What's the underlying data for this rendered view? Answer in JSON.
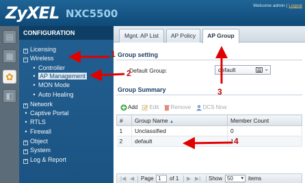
{
  "header": {
    "brand": "ZyXEL",
    "model": "NXC5500",
    "welcome": "Welcome admin |",
    "logout": "Logout"
  },
  "rail": {
    "icons": [
      "dashboard-icon",
      "monitor-icon",
      "configuration-icon",
      "maintenance-icon"
    ],
    "active": "configuration-icon"
  },
  "sidebar": {
    "title": "CONFIGURATION",
    "items": [
      {
        "label": "Licensing",
        "type": "collapsed"
      },
      {
        "label": "Wireless",
        "type": "expanded"
      },
      {
        "label": "Controller",
        "type": "child"
      },
      {
        "label": "AP Management",
        "type": "child",
        "selected": true
      },
      {
        "label": "MON Mode",
        "type": "child"
      },
      {
        "label": "Auto Healing",
        "type": "child"
      },
      {
        "label": "Network",
        "type": "collapsed"
      },
      {
        "label": "Captive Portal",
        "type": "leaf"
      },
      {
        "label": "RTLS",
        "type": "leaf"
      },
      {
        "label": "Firewall",
        "type": "leaf"
      },
      {
        "label": "Object",
        "type": "collapsed"
      },
      {
        "label": "System",
        "type": "collapsed"
      },
      {
        "label": "Log & Report",
        "type": "collapsed"
      }
    ]
  },
  "tabs": [
    {
      "label": "Mgnt. AP List",
      "active": false
    },
    {
      "label": "AP Policy",
      "active": false
    },
    {
      "label": "AP Group",
      "active": true
    }
  ],
  "group_setting": {
    "title": "Group setting",
    "default_group_label": "Default Group:",
    "default_group_value": "default"
  },
  "group_summary": {
    "title": "Group Summary",
    "toolbar": {
      "add": "Add",
      "edit": "Edit",
      "remove": "Remove",
      "dcs_now": "DCS Now"
    },
    "columns": [
      "#",
      "Group Name",
      "Member Count"
    ],
    "rows": [
      {
        "index": "1",
        "name": "Unclassified",
        "members": "0"
      },
      {
        "index": "2",
        "name": "default",
        "members": "1"
      }
    ],
    "pager": {
      "page_label": "Page",
      "page": "1",
      "of_label": "of 1",
      "show_label": "Show",
      "per_page": "50",
      "items_label": "items"
    }
  },
  "annotations": {
    "color": "#e00000",
    "numbers": [
      "1",
      "2",
      "3",
      "4"
    ]
  }
}
